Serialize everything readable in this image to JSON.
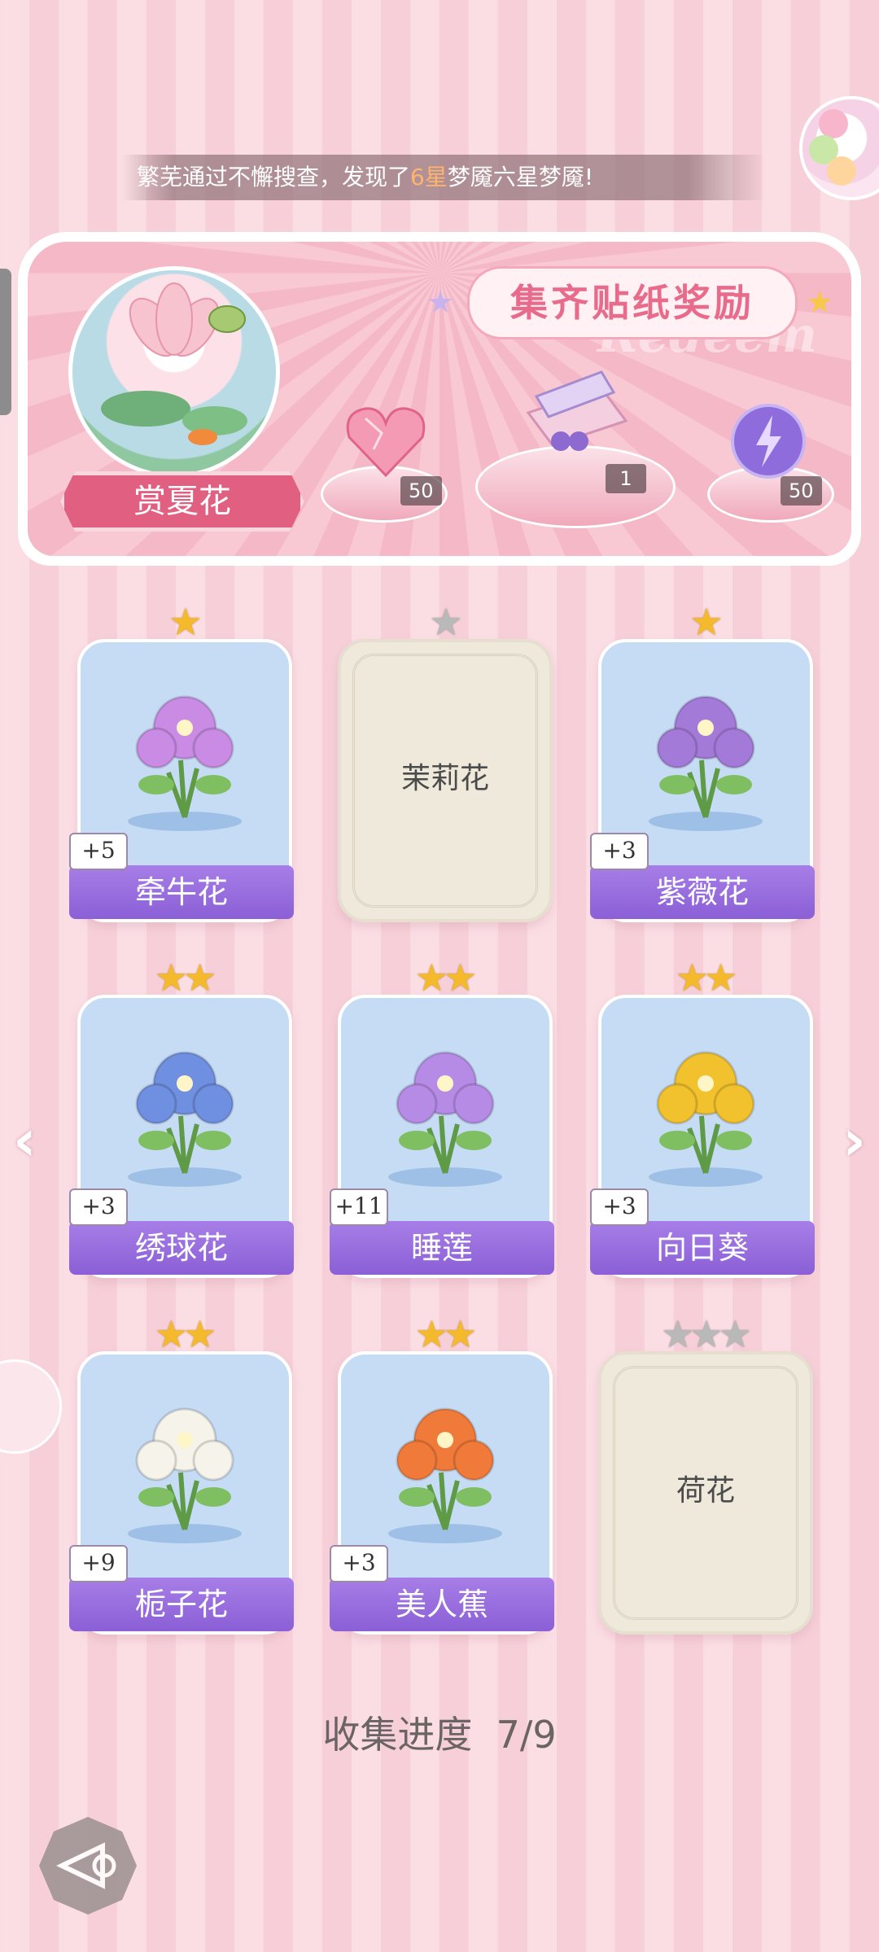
{
  "ticker": {
    "prefix": "繁芜通过不懈搜查，发现了",
    "highlight": "6星",
    "suffix": "梦魇六星梦魇!"
  },
  "banner": {
    "title": "集齐贴纸奖励",
    "watermark": "Redeem",
    "theme_label": "赏夏花",
    "rewards": [
      {
        "icon": "pink-heart-gem-icon",
        "count": "50"
      },
      {
        "icon": "gift-box-icon",
        "count": "1"
      },
      {
        "icon": "purple-energy-orb-icon",
        "count": "50"
      }
    ]
  },
  "cards": [
    {
      "name": "牵牛花",
      "stars": 1,
      "collected": true,
      "bonus": "+5",
      "art": "morning-glory-icon",
      "color": "#c98be3"
    },
    {
      "name": "茉莉花",
      "stars": 1,
      "collected": false
    },
    {
      "name": "紫薇花",
      "stars": 1,
      "collected": true,
      "bonus": "+3",
      "art": "crape-myrtle-icon",
      "color": "#a47ad9"
    },
    {
      "name": "绣球花",
      "stars": 2,
      "collected": true,
      "bonus": "+3",
      "art": "hydrangea-bouquet-icon",
      "color": "#6f8fe0"
    },
    {
      "name": "睡莲",
      "stars": 2,
      "collected": true,
      "bonus": "+11",
      "art": "water-lily-icon",
      "color": "#b68be6"
    },
    {
      "name": "向日葵",
      "stars": 2,
      "collected": true,
      "bonus": "+3",
      "art": "sunflower-bouquet-icon",
      "color": "#f2c12e"
    },
    {
      "name": "栀子花",
      "stars": 2,
      "collected": true,
      "bonus": "+9",
      "art": "gardenia-vase-icon",
      "color": "#f5f3ea"
    },
    {
      "name": "美人蕉",
      "stars": 2,
      "collected": true,
      "bonus": "+3",
      "art": "canna-bouquet-icon",
      "color": "#f07a3a"
    },
    {
      "name": "荷花",
      "stars": 3,
      "collected": false
    }
  ],
  "progress": {
    "label": "收集进度",
    "value": "7/9"
  },
  "colors": {
    "accent_purple": "#8b5fd6",
    "banner_pink": "#e15f80",
    "star_gold": "#f5b92c"
  }
}
